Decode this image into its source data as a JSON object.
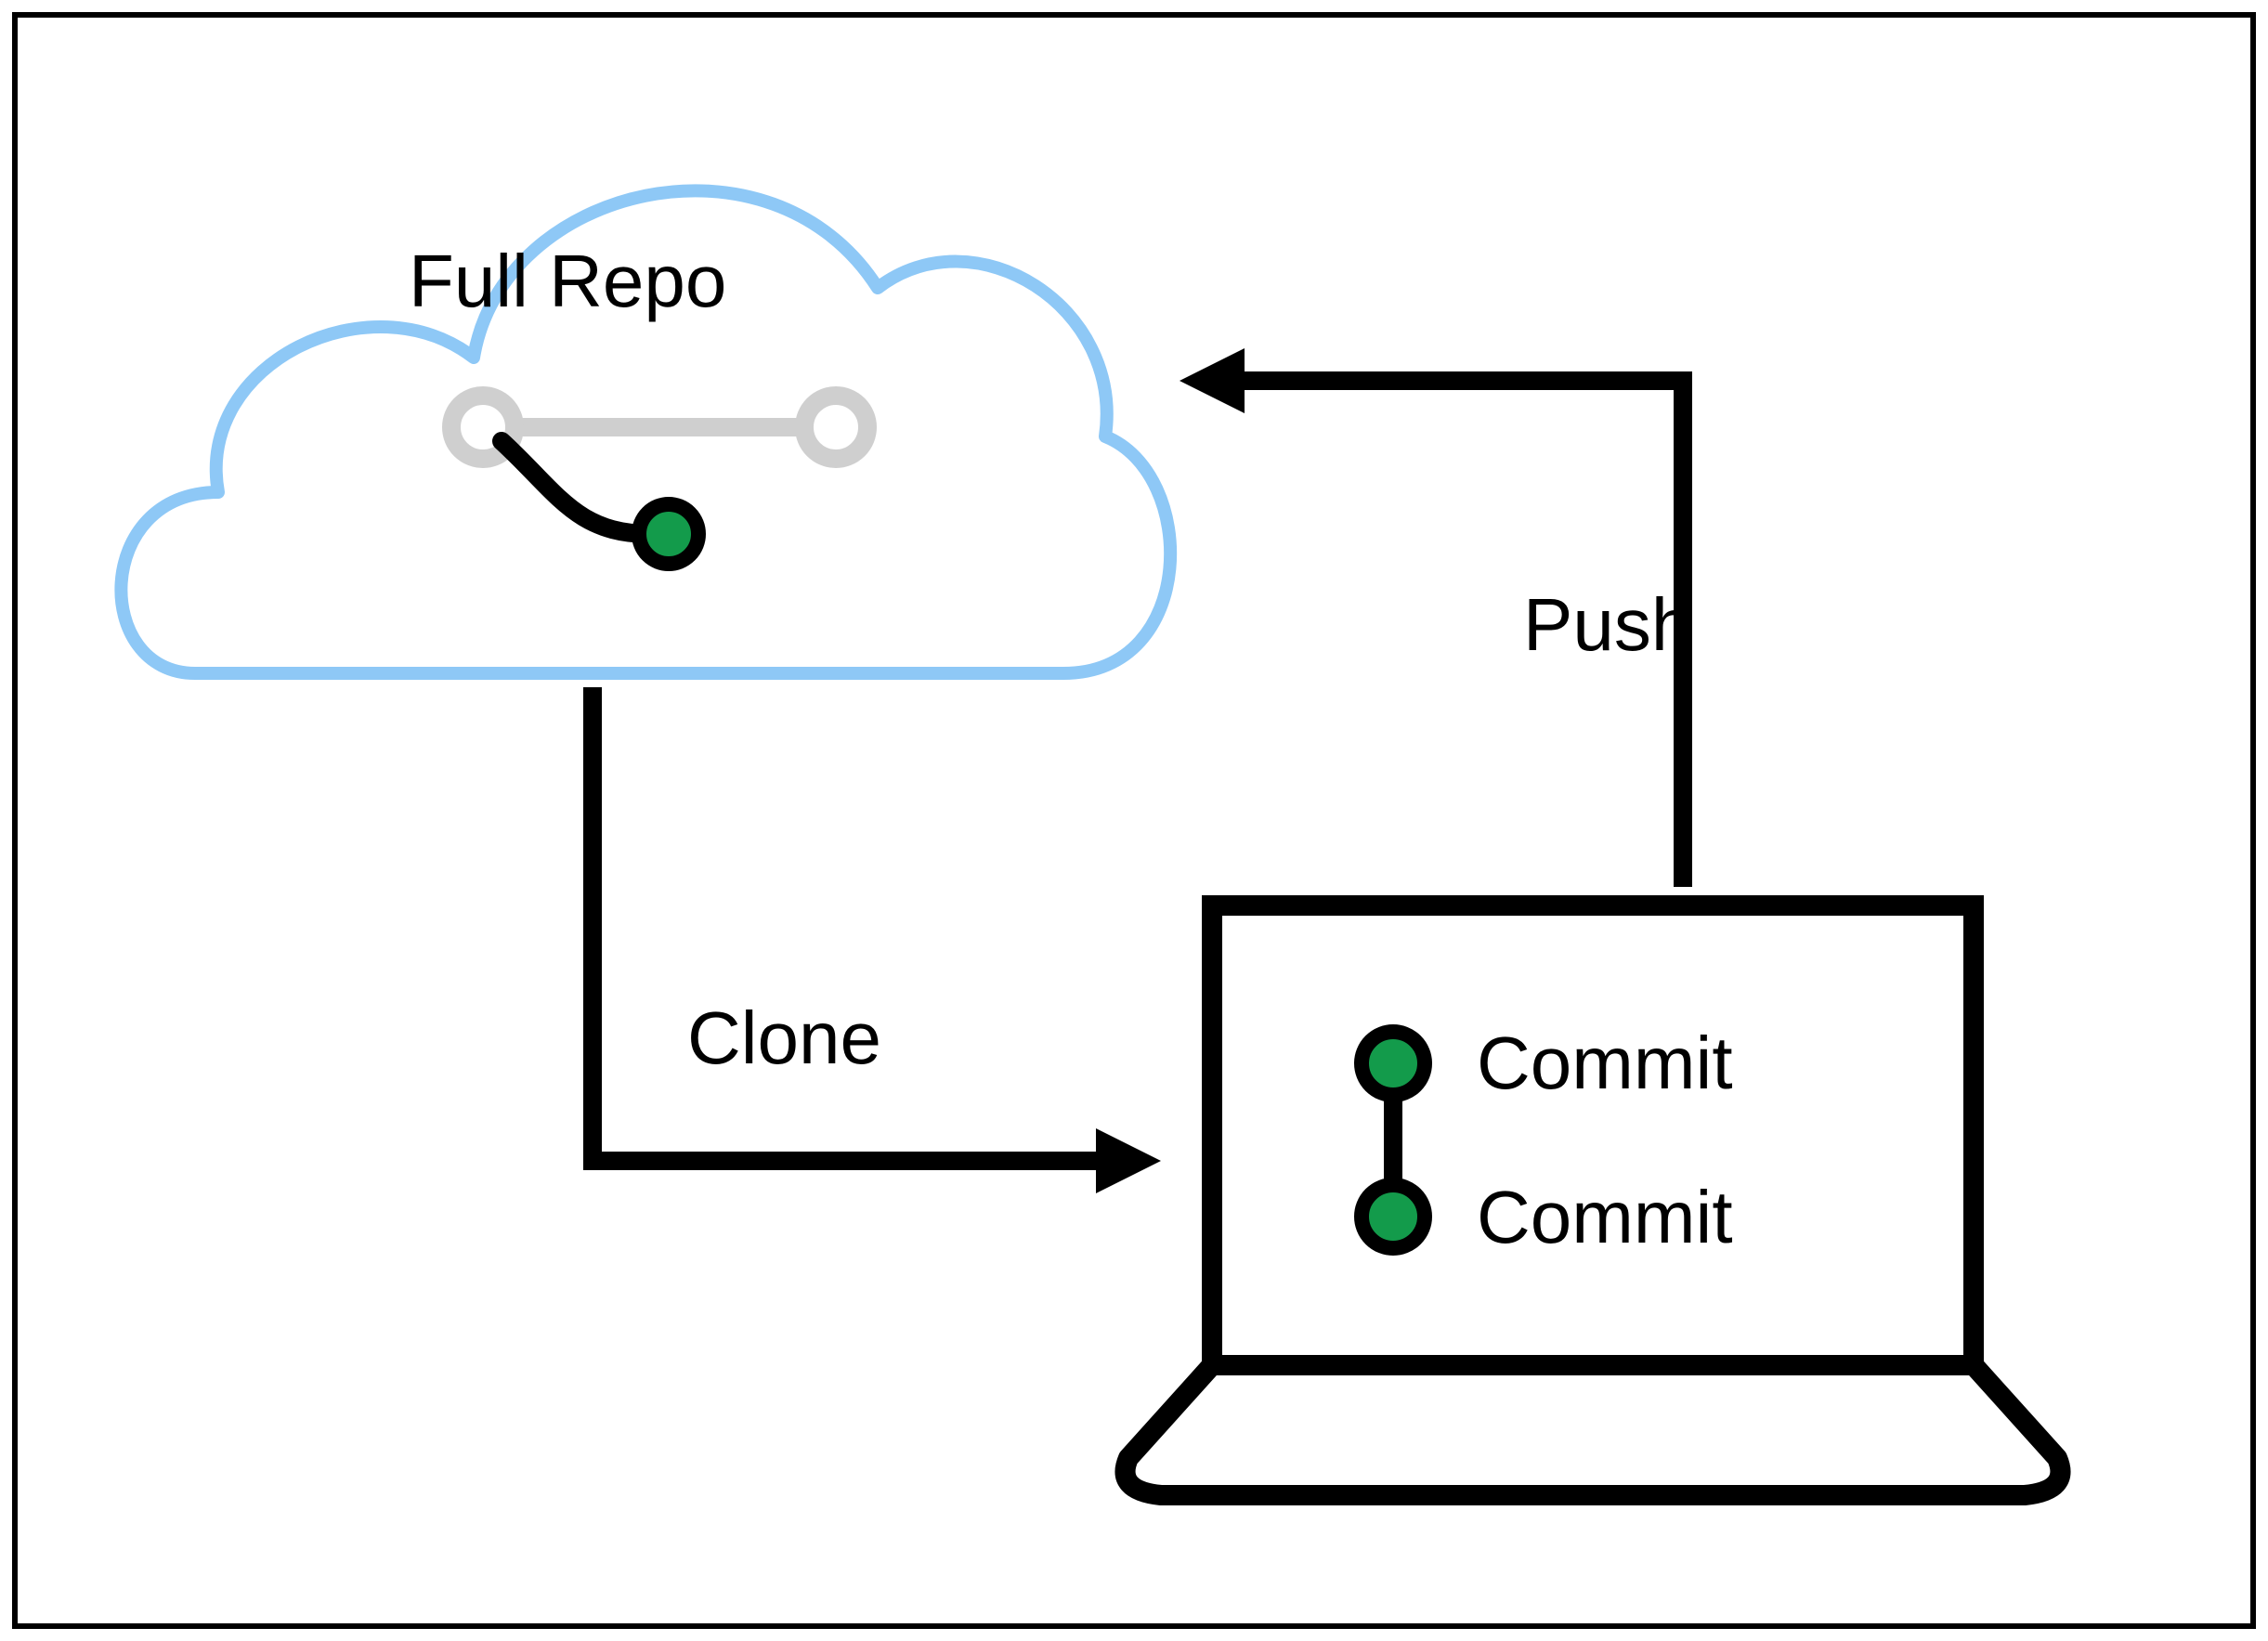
{
  "diagram": {
    "cloud_label": "Full Repo",
    "arrow_clone_label": "Clone",
    "arrow_push_label": "Push",
    "commits": [
      "Commit",
      "Commit"
    ],
    "colors": {
      "cloud_stroke": "#8ec8f6",
      "commit_fill": "#139b4b",
      "faded": "#cfcfcf",
      "line": "#000000"
    }
  }
}
